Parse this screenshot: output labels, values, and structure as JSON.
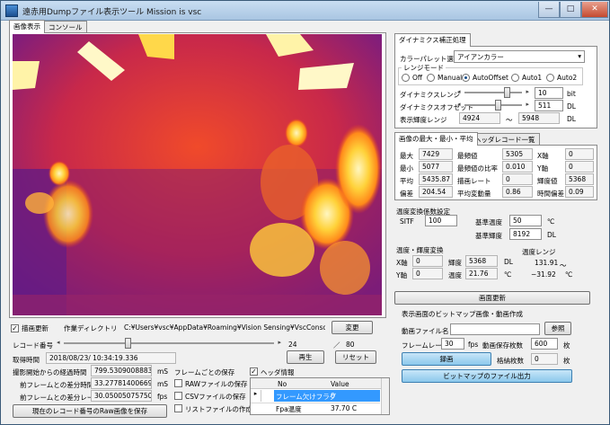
{
  "window": {
    "title": "遠赤用Dumpファイル表示ツール Mission is vsc",
    "min": "—",
    "max": "□",
    "close": "✕"
  },
  "left_tabs": [
    "画像表示",
    "コンソール"
  ],
  "image": {
    "icon": "thermal-image"
  },
  "draw_update": {
    "label": "描画更新",
    "checked": true
  },
  "work_dir": {
    "label": "作業ディレクトリ",
    "value": "C:¥Users¥vsc¥AppData¥Roaming¥Vision Sensing¥VscConsoleForm_LW¥",
    "change_btn": "変更"
  },
  "record": {
    "label": "レコード番号",
    "value": "24",
    "separator": "／",
    "total": "80",
    "position": 0.3
  },
  "acquired": {
    "label": "取得時間",
    "value": "2018/08/23/ 10:34:19.336"
  },
  "stats": [
    {
      "label": "撮影開始からの経過時間",
      "value": "799.530900888381",
      "unit": "mS"
    },
    {
      "label": "前フレームとの差分時間",
      "value": "33.2778140066923",
      "unit": "mS"
    },
    {
      "label": "前フレームとの差分レート",
      "value": "30.0500507575076",
      "unit": "fps"
    }
  ],
  "play_btn": "再生",
  "reset_btn": "リセット",
  "save_raw_btn": "現在のレコード番号のRaw画像を保存",
  "frame_save": {
    "title": "フレームごとの保存",
    "items": [
      {
        "label": "RAWファイルの保存",
        "checked": false
      },
      {
        "label": "CSVファイルの保存",
        "checked": false
      },
      {
        "label": "リストファイルの作成",
        "checked": false
      }
    ]
  },
  "header_info": {
    "label": "ヘッダ情報",
    "checked": true,
    "columns": [
      "No",
      "Value"
    ],
    "rows": [
      {
        "no": "フレーム欠けフラグ",
        "value": "0",
        "selected": true
      },
      {
        "no": "Fpa温度",
        "value": "37.70 C",
        "selected": false
      }
    ]
  },
  "dynamics": {
    "tab": "ダイナミクス補正処理",
    "palette_label": "カラーパレット選択",
    "palette_value": "アイアンカラー",
    "range_mode": {
      "title": "レンジモード",
      "options": [
        "Off",
        "Manual",
        "AutoOffset",
        "Auto1",
        "Auto2"
      ],
      "selected": 2
    },
    "range": {
      "label": "ダイナミクスレンジ",
      "value": "10",
      "unit": "bit",
      "position": 0.78
    },
    "offset": {
      "label": "ダイナミクスオフセット",
      "value": "511",
      "unit": "DL",
      "position": 0.6
    },
    "brightness": {
      "label": "表示輝度レンジ",
      "min": "4924",
      "sep": "〜",
      "max": "5948",
      "unit": "DL"
    }
  },
  "minmax": {
    "tabs": [
      "画像の最大・最小・平均",
      "ヘッダレコード一覧"
    ],
    "rows": [
      [
        {
          "l": "最大",
          "v": "7429"
        },
        {
          "l": "最頻値",
          "v": "5305"
        },
        {
          "l": "X軸",
          "v": "0"
        }
      ],
      [
        {
          "l": "最小",
          "v": "5077"
        },
        {
          "l": "最頻値の比率",
          "v": "0.010"
        },
        {
          "l": "Y軸",
          "v": "0"
        }
      ],
      [
        {
          "l": "平均",
          "v": "5435.87"
        },
        {
          "l": "描画レート",
          "v": "0"
        },
        {
          "l": "輝度値",
          "v": "5368"
        }
      ],
      [
        {
          "l": "偏差",
          "v": "204.54"
        },
        {
          "l": "平均変動量",
          "v": "0.86"
        },
        {
          "l": "時間偏差",
          "v": "0.09"
        }
      ]
    ]
  },
  "temp_coef": {
    "title": "温度変換係数設定",
    "sitf_label": "SITF",
    "sitf_value": "100",
    "base_temp_label": "基準温度",
    "base_temp_value": "50",
    "base_temp_unit": "℃",
    "base_bright_label": "基準輝度",
    "base_bright_value": "8192",
    "base_bright_unit": "DL"
  },
  "temp_convert": {
    "title": "温度・輝度変換",
    "x_label": "X軸",
    "x_value": "0",
    "y_label": "Y軸",
    "y_value": "0",
    "bright_label": "輝度",
    "bright_value": "5368",
    "bright_unit": "DL",
    "temp_label": "温度",
    "temp_value": "21.76",
    "temp_unit": "℃"
  },
  "temp_range": {
    "title": "温度レンジ",
    "max": "131.91",
    "sep": "〜",
    "min": "−31.92",
    "unit": "℃"
  },
  "refresh_btn": "画面更新",
  "bitmap": {
    "title": "表示画面のビットマップ画像・動画作成",
    "file_label": "動画ファイル名",
    "file_value": "",
    "browse_btn": "参照",
    "framerate_label": "フレームレート",
    "framerate_value": "30",
    "framerate_unit": "fps",
    "saved_label": "動画保存枚数",
    "saved_value": "600",
    "saved_unit": "枚",
    "record_btn": "録画",
    "stored_label": "格納枚数",
    "stored_value": "0",
    "stored_unit": "枚",
    "export_btn": "ビットマップのファイル出力"
  }
}
